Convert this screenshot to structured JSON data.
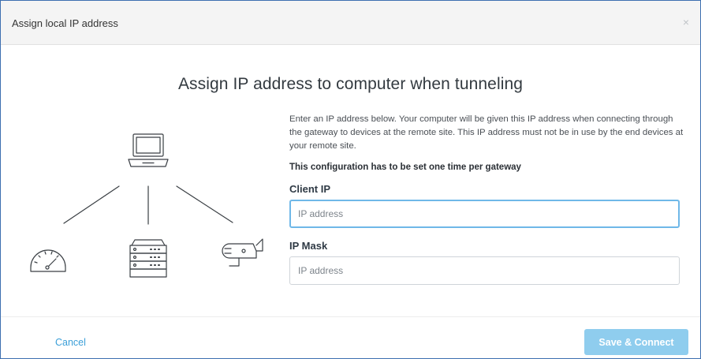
{
  "dialog": {
    "title": "Assign local IP address",
    "close_symbol": "×"
  },
  "heading": "Assign IP address to computer when tunneling",
  "description": "Enter an IP address below. Your computer will be given this IP address when connecting through the gateway to devices at the remote site. This IP address must not be in use by the end devices at your remote site.",
  "config_note": "This configuration has to be set one time per gateway",
  "client_ip": {
    "label": "Client IP",
    "placeholder": "IP address",
    "value": ""
  },
  "ip_mask": {
    "label": "IP Mask",
    "placeholder": "IP address",
    "value": ""
  },
  "footer": {
    "cancel_label": "Cancel",
    "submit_label": "Save & Connect"
  },
  "illustration": {
    "icons": [
      "laptop-icon",
      "gauge-icon",
      "server-rack-icon",
      "camera-icon"
    ]
  },
  "colors": {
    "border": "#3d6fb0",
    "focus_border": "#6fb8e8",
    "link": "#3b9fd8",
    "button_disabled": "#8fcdee",
    "icon_stroke": "#3a3f44"
  }
}
